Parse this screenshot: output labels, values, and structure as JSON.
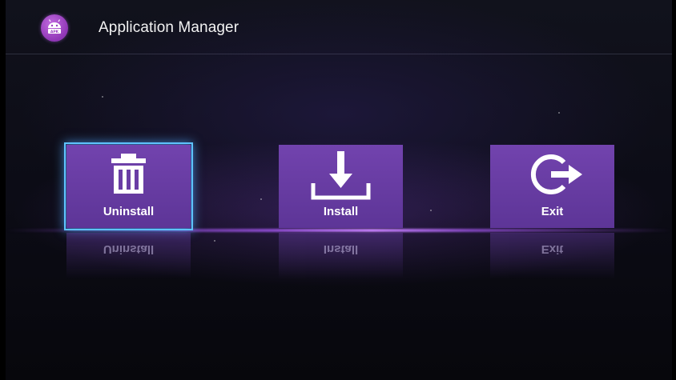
{
  "header": {
    "title": "Application Manager",
    "icon": "android-apk-icon"
  },
  "tiles": [
    {
      "label": "Uninstall",
      "icon": "trash-icon",
      "selected": true
    },
    {
      "label": "Install",
      "icon": "download-icon",
      "selected": false
    },
    {
      "label": "Exit",
      "icon": "exit-icon",
      "selected": false
    }
  ],
  "colors": {
    "tile": "#6a3da5",
    "focus": "#5fc2ff",
    "app_icon": "#a348c8"
  }
}
